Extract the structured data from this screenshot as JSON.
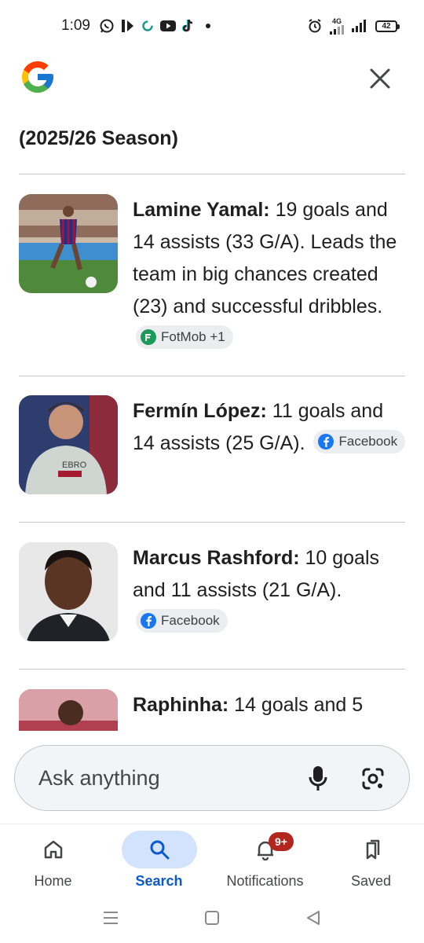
{
  "status_bar": {
    "time": "1:09",
    "network": "4G",
    "battery": "42",
    "left_icons": [
      "whatsapp-icon",
      "bolt-icon",
      "sync-icon",
      "youtube-icon",
      "tiktok-icon",
      "dot-icon"
    ],
    "right_icons": [
      "alarm-icon",
      "signal-4g-icon",
      "signal-bars-icon",
      "battery-icon"
    ]
  },
  "header": {
    "logo": "google-g-logo",
    "close_icon": "close-icon"
  },
  "content": {
    "season_title": "(2025/26 Season)",
    "players": [
      {
        "name": "Lamine Yamal:",
        "description": " 19 goals and 14 assists (33 G/A). Leads the team in big chances created (23) and successful dribbles.",
        "source": "FotMob +1",
        "source_icon": "fotmob-icon"
      },
      {
        "name": "Fermín López:",
        "description": " 11 goals and 14 assists (25 G/A).",
        "source": "Facebook",
        "source_icon": "facebook-icon"
      },
      {
        "name": "Marcus Rashford:",
        "description": " 10 goals and 11 assists (21 G/A).",
        "source": "Facebook",
        "source_icon": "facebook-icon"
      },
      {
        "name": "Raphinha:",
        "description": " 14 goals and 5",
        "source": "",
        "source_icon": ""
      }
    ]
  },
  "ask_bar": {
    "placeholder": "Ask anything",
    "mic_icon": "microphone-icon",
    "lens_icon": "lens-camera-icon"
  },
  "bottom_nav": {
    "items": [
      {
        "label": "Home",
        "icon": "home-icon",
        "active": false
      },
      {
        "label": "Search",
        "icon": "search-icon",
        "active": true
      },
      {
        "label": "Notifications",
        "icon": "bell-icon",
        "active": false,
        "badge": "9+"
      },
      {
        "label": "Saved",
        "icon": "bookmarks-icon",
        "active": false
      }
    ]
  },
  "system_nav": {
    "icons": [
      "recents-icon",
      "home-square-icon",
      "back-triangle-icon"
    ]
  },
  "colors": {
    "accent": "#0b57d0",
    "active_pill": "#d3e3fd",
    "badge": "#b3261e",
    "chip_bg": "#ecedf0",
    "divider": "#c4c7c5"
  }
}
